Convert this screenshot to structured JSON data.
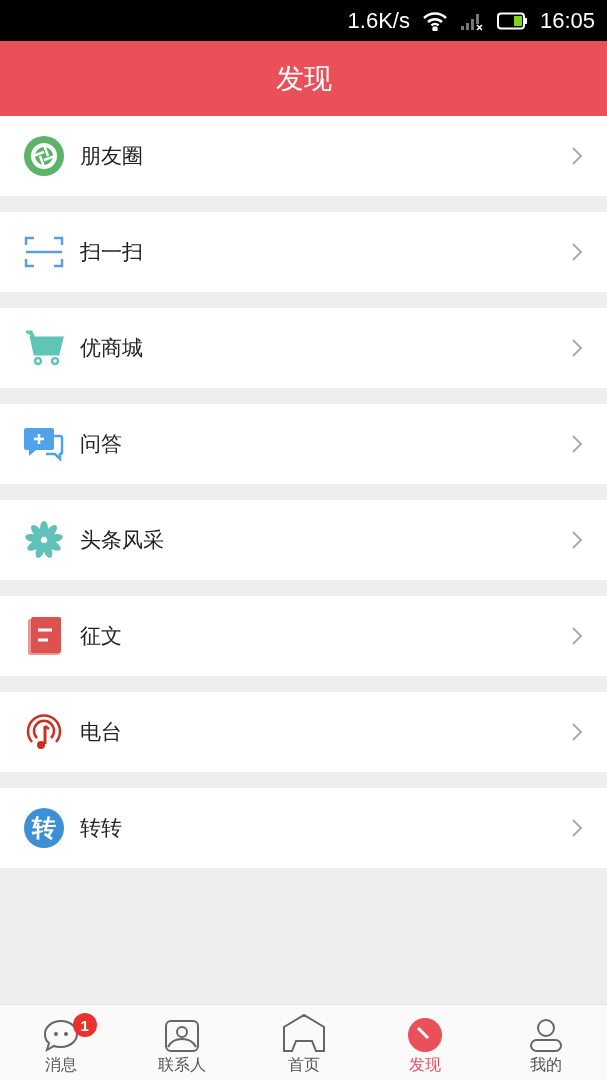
{
  "status_bar": {
    "speed": "1.6K/s",
    "time": "16:05"
  },
  "header": {
    "title": "发现"
  },
  "items": [
    {
      "kind": "moments",
      "label": "朋友圈"
    },
    {
      "kind": "scan",
      "label": "扫一扫"
    },
    {
      "kind": "shop",
      "label": "优商城"
    },
    {
      "kind": "qa",
      "label": "问答"
    },
    {
      "kind": "flower",
      "label": "头条风采"
    },
    {
      "kind": "essay",
      "label": "征文"
    },
    {
      "kind": "radio",
      "label": "电台"
    },
    {
      "kind": "zhuan",
      "label": "转转",
      "icon_text": "转"
    }
  ],
  "tabs": [
    {
      "kind": "chat",
      "label": "消息",
      "selected": false,
      "badge": "1"
    },
    {
      "kind": "contacts",
      "label": "联系人",
      "selected": false
    },
    {
      "kind": "home",
      "label": "首页",
      "selected": false
    },
    {
      "kind": "discover",
      "label": "发现",
      "selected": true
    },
    {
      "kind": "me",
      "label": "我的",
      "selected": false
    }
  ]
}
